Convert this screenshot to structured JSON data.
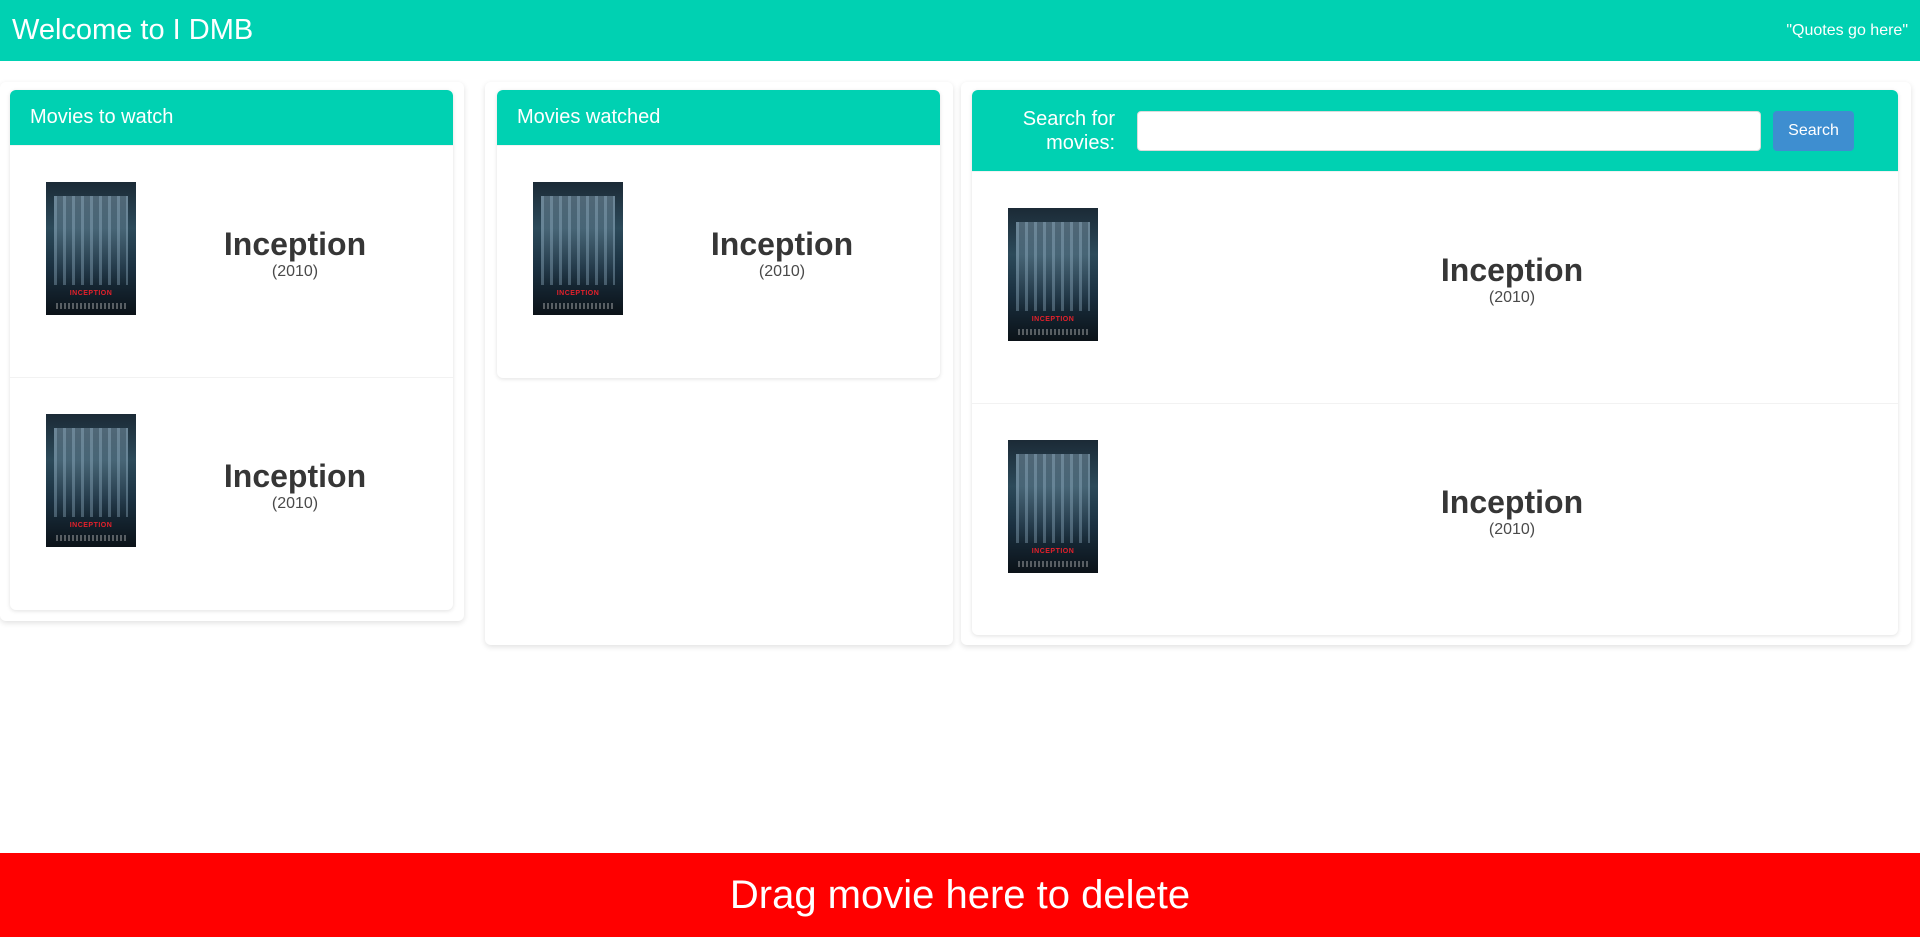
{
  "header": {
    "title": "Welcome to I DMB",
    "quote": "\"Quotes go here\""
  },
  "columns": {
    "to_watch": {
      "title": "Movies to watch",
      "movies": [
        {
          "title": "Inception",
          "year": "(2010)",
          "poster_text": "INCEPTION"
        },
        {
          "title": "Inception",
          "year": "(2010)",
          "poster_text": "INCEPTION"
        }
      ]
    },
    "watched": {
      "title": "Movies watched",
      "movies": [
        {
          "title": "Inception",
          "year": "(2010)",
          "poster_text": "INCEPTION"
        }
      ]
    },
    "search": {
      "label": "Search for movies:",
      "input_value": "",
      "button_label": "Search",
      "results": [
        {
          "title": "Inception",
          "year": "(2010)",
          "poster_text": "INCEPTION"
        },
        {
          "title": "Inception",
          "year": "(2010)",
          "poster_text": "INCEPTION"
        }
      ]
    }
  },
  "delete_zone": {
    "label": "Drag movie here to delete"
  },
  "colors": {
    "primary": "#00d1b2",
    "button": "#3e8ed0",
    "danger": "#ff0000"
  }
}
